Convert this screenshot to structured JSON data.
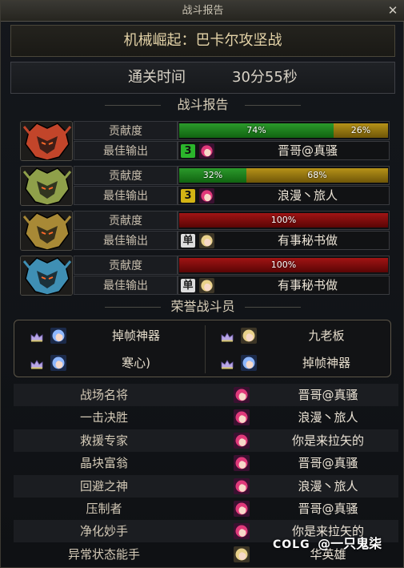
{
  "window": {
    "title": "战斗报告",
    "close_glyph": "✕"
  },
  "dungeon": {
    "name": "机械崛起：巴卡尔攻坚战"
  },
  "clear_time": {
    "label": "通关时间",
    "value": "30分55秒"
  },
  "report_section": {
    "title": "战斗报告"
  },
  "row_labels": {
    "contribution": "贡献度",
    "best_output": "最佳输出"
  },
  "reports": [
    {
      "boss_icon": "red-dragon-helm-icon",
      "boss_color": "#c2452a",
      "contribution": [
        {
          "label": "74%",
          "fraction": 0.74,
          "color": "green"
        },
        {
          "label": "26%",
          "fraction": 0.26,
          "color": "gold"
        }
      ],
      "best_party": {
        "badge": "3",
        "badge_color": "#2bb52b"
      },
      "best_player": "晋哥@真骚"
    },
    {
      "boss_icon": "green-dragon-helm-icon",
      "boss_color": "#8fa04a",
      "contribution": [
        {
          "label": "32%",
          "fraction": 0.32,
          "color": "green"
        },
        {
          "label": "68%",
          "fraction": 0.68,
          "color": "gold"
        }
      ],
      "best_party": {
        "badge": "3",
        "badge_color": "#d4b414"
      },
      "best_player": "浪漫丶旅人"
    },
    {
      "boss_icon": "gold-dragon-helm-icon",
      "boss_color": "#a88936",
      "contribution": [
        {
          "label": "100%",
          "fraction": 1.0,
          "color": "red"
        }
      ],
      "best_party": {
        "badge": "单",
        "badge_color": "#dddddd"
      },
      "best_player": "有事秘书做"
    },
    {
      "boss_icon": "blue-dragon-helm-icon",
      "boss_color": "#3f8fb4",
      "contribution": [
        {
          "label": "100%",
          "fraction": 1.0,
          "color": "red"
        }
      ],
      "best_party": {
        "badge": "单",
        "badge_color": "#dddddd"
      },
      "best_player": "有事秘书做"
    }
  ],
  "honor_section": {
    "title": "荣誉战斗员"
  },
  "honor_players": [
    {
      "name": "掉帧神器",
      "portrait": "blue-haired-character-icon"
    },
    {
      "name": "九老板",
      "portrait": "blonde-character-icon"
    },
    {
      "name": "寒心)",
      "portrait": "blue-haired-character-icon"
    },
    {
      "name": "掉帧神器",
      "portrait": "blue-haired-character-icon"
    }
  ],
  "awards": [
    {
      "title": "战场名将",
      "player": "晋哥@真骚",
      "portrait": "pink-haired-character-icon"
    },
    {
      "title": "一击决胜",
      "player": "浪漫丶旅人",
      "portrait": "pink-haired-character-icon"
    },
    {
      "title": "救援专家",
      "player": "你是来拉矢的",
      "portrait": "pink-haired-character-icon"
    },
    {
      "title": "晶块富翁",
      "player": "晋哥@真骚",
      "portrait": "pink-haired-character-icon"
    },
    {
      "title": "回避之神",
      "player": "浪漫丶旅人",
      "portrait": "pink-haired-character-icon"
    },
    {
      "title": "压制者",
      "player": "晋哥@真骚",
      "portrait": "pink-haired-character-icon"
    },
    {
      "title": "净化妙手",
      "player": "你是来拉矢的",
      "portrait": "pink-haired-character-icon"
    },
    {
      "title": "异常状态能手",
      "player": "华英雄",
      "portrait": "blonde-character-icon"
    }
  ],
  "watermark": {
    "brand": "COLG",
    "text": "@一只鬼柒"
  }
}
